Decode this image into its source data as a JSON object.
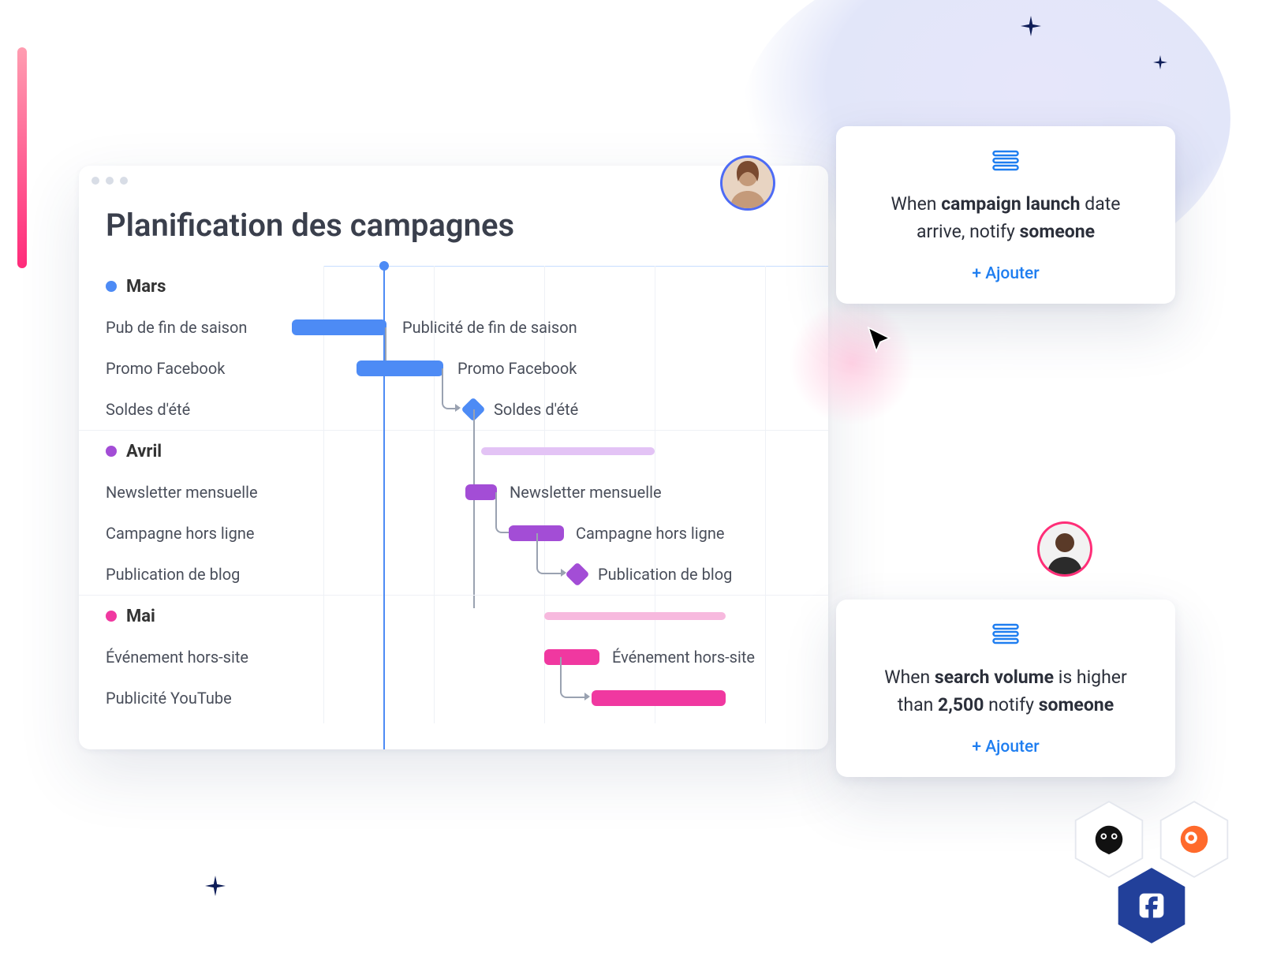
{
  "window": {
    "title": "Planification des campagnes"
  },
  "months": {
    "mars": {
      "label": "Mars",
      "color": "blue"
    },
    "avril": {
      "label": "Avril",
      "color": "purple"
    },
    "mai": {
      "label": "Mai",
      "color": "pink"
    }
  },
  "tasks": {
    "mars": [
      {
        "list_label": "Pub de fin de saison",
        "bar_label": "Publicité de fin de saison"
      },
      {
        "list_label": "Promo Facebook",
        "bar_label": "Promo Facebook"
      },
      {
        "list_label": "Soldes d'été",
        "bar_label": "Soldes d'été"
      }
    ],
    "avril": [
      {
        "list_label": "Newsletter mensuelle",
        "bar_label": "Newsletter mensuelle"
      },
      {
        "list_label": "Campagne hors ligne",
        "bar_label": "Campagne hors ligne"
      },
      {
        "list_label": "Publication de blog",
        "bar_label": "Publication de blog"
      }
    ],
    "mai": [
      {
        "list_label": "Événement hors-site",
        "bar_label": "Événement hors-site"
      },
      {
        "list_label": "Publicité YouTube",
        "bar_label": ""
      }
    ]
  },
  "cards": {
    "one": {
      "pre": "When ",
      "bold1": "campaign launch",
      "mid": " date arrive, notify ",
      "bold2": "someone",
      "action": "+ Ajouter"
    },
    "two": {
      "pre": "When ",
      "bold1": "search volume",
      "mid": " is higher than ",
      "bold2": "2,500",
      "mid2": " notify ",
      "bold3": "someone",
      "action": "+ Ajouter"
    }
  },
  "colors": {
    "blue": "#4d8bf5",
    "purple": "#a34dd6",
    "pink": "#f038a0",
    "accent": "#1f7ef0"
  },
  "integrations": {
    "hootsuite": "Hootsuite",
    "semrush": "Semrush",
    "facebook": "Facebook"
  }
}
